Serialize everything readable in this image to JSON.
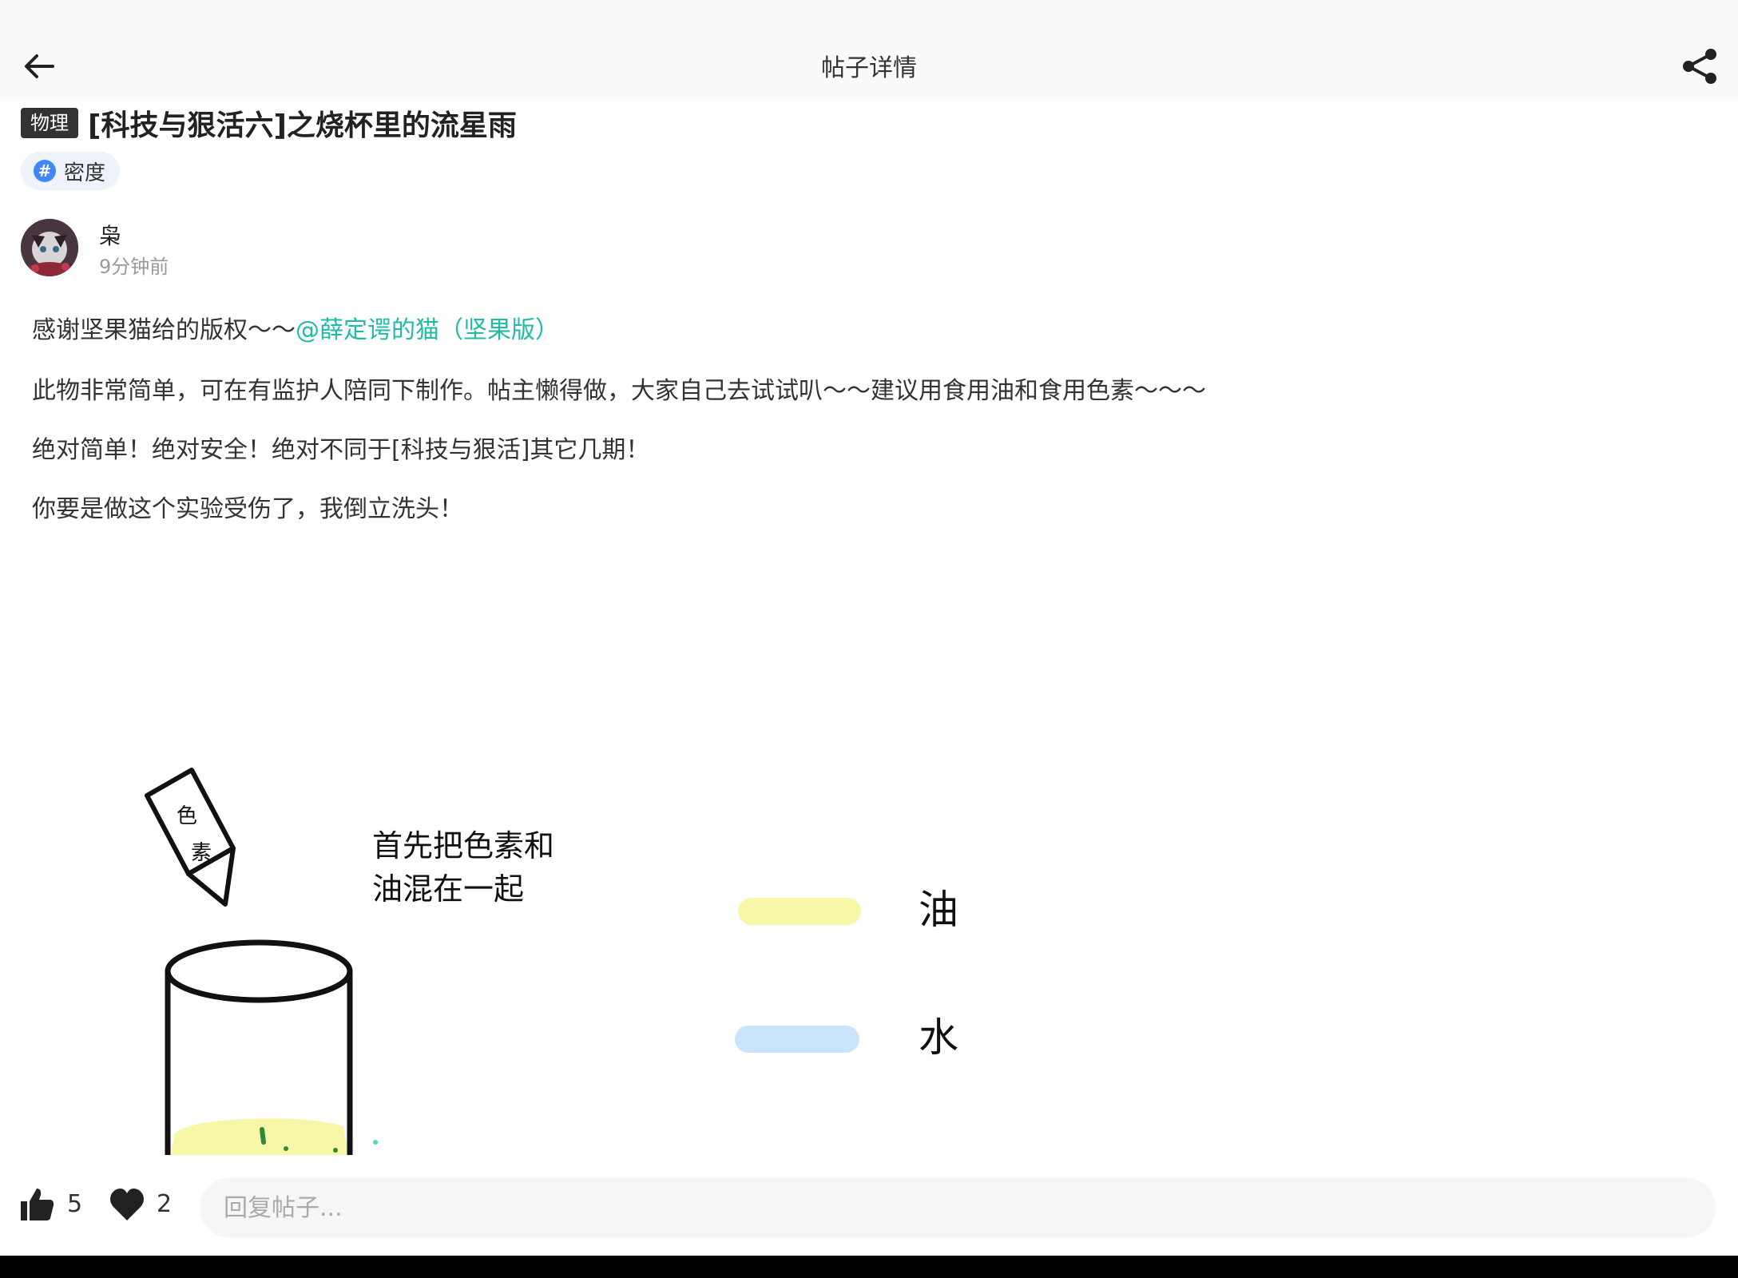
{
  "header": {
    "title": "帖子详情",
    "back_icon": "arrow-left-icon",
    "share_icon": "share-icon"
  },
  "post": {
    "category": "物理",
    "title": "[科技与狠活六]之烧杯里的流星雨",
    "tag": {
      "icon": "hash-icon",
      "label": "密度"
    },
    "author": {
      "name": "枭",
      "time": "9分钟前"
    },
    "paragraphs": {
      "p1_text": "感谢坚果猫给的版权～～",
      "p1_mention": "@薛定谔的猫（坚果版）",
      "p2": "此物非常简单，可在有监护人陪同下制作。帖主懒得做，大家自己去试试叭～～建议用食用油和食用色素～～～",
      "p3": "绝对简单！绝对安全！绝对不同于[科技与狠活]其它几期！",
      "p4": "你要是做这个实验受伤了，我倒立洗头！"
    },
    "figure": {
      "packet_chars": [
        "色",
        "素"
      ],
      "caption_line1": "首先把色素和",
      "caption_line2": "油混在一起",
      "legend": [
        {
          "label": "油",
          "color": "#f8f7a8"
        },
        {
          "label": "水",
          "color": "#c9e4fb"
        }
      ]
    }
  },
  "bottom": {
    "like_count": "5",
    "fav_count": "2",
    "reply_placeholder": "回复帖子..."
  },
  "colors": {
    "mention": "#1fbba6",
    "tag_hash": "#3f88f5"
  }
}
